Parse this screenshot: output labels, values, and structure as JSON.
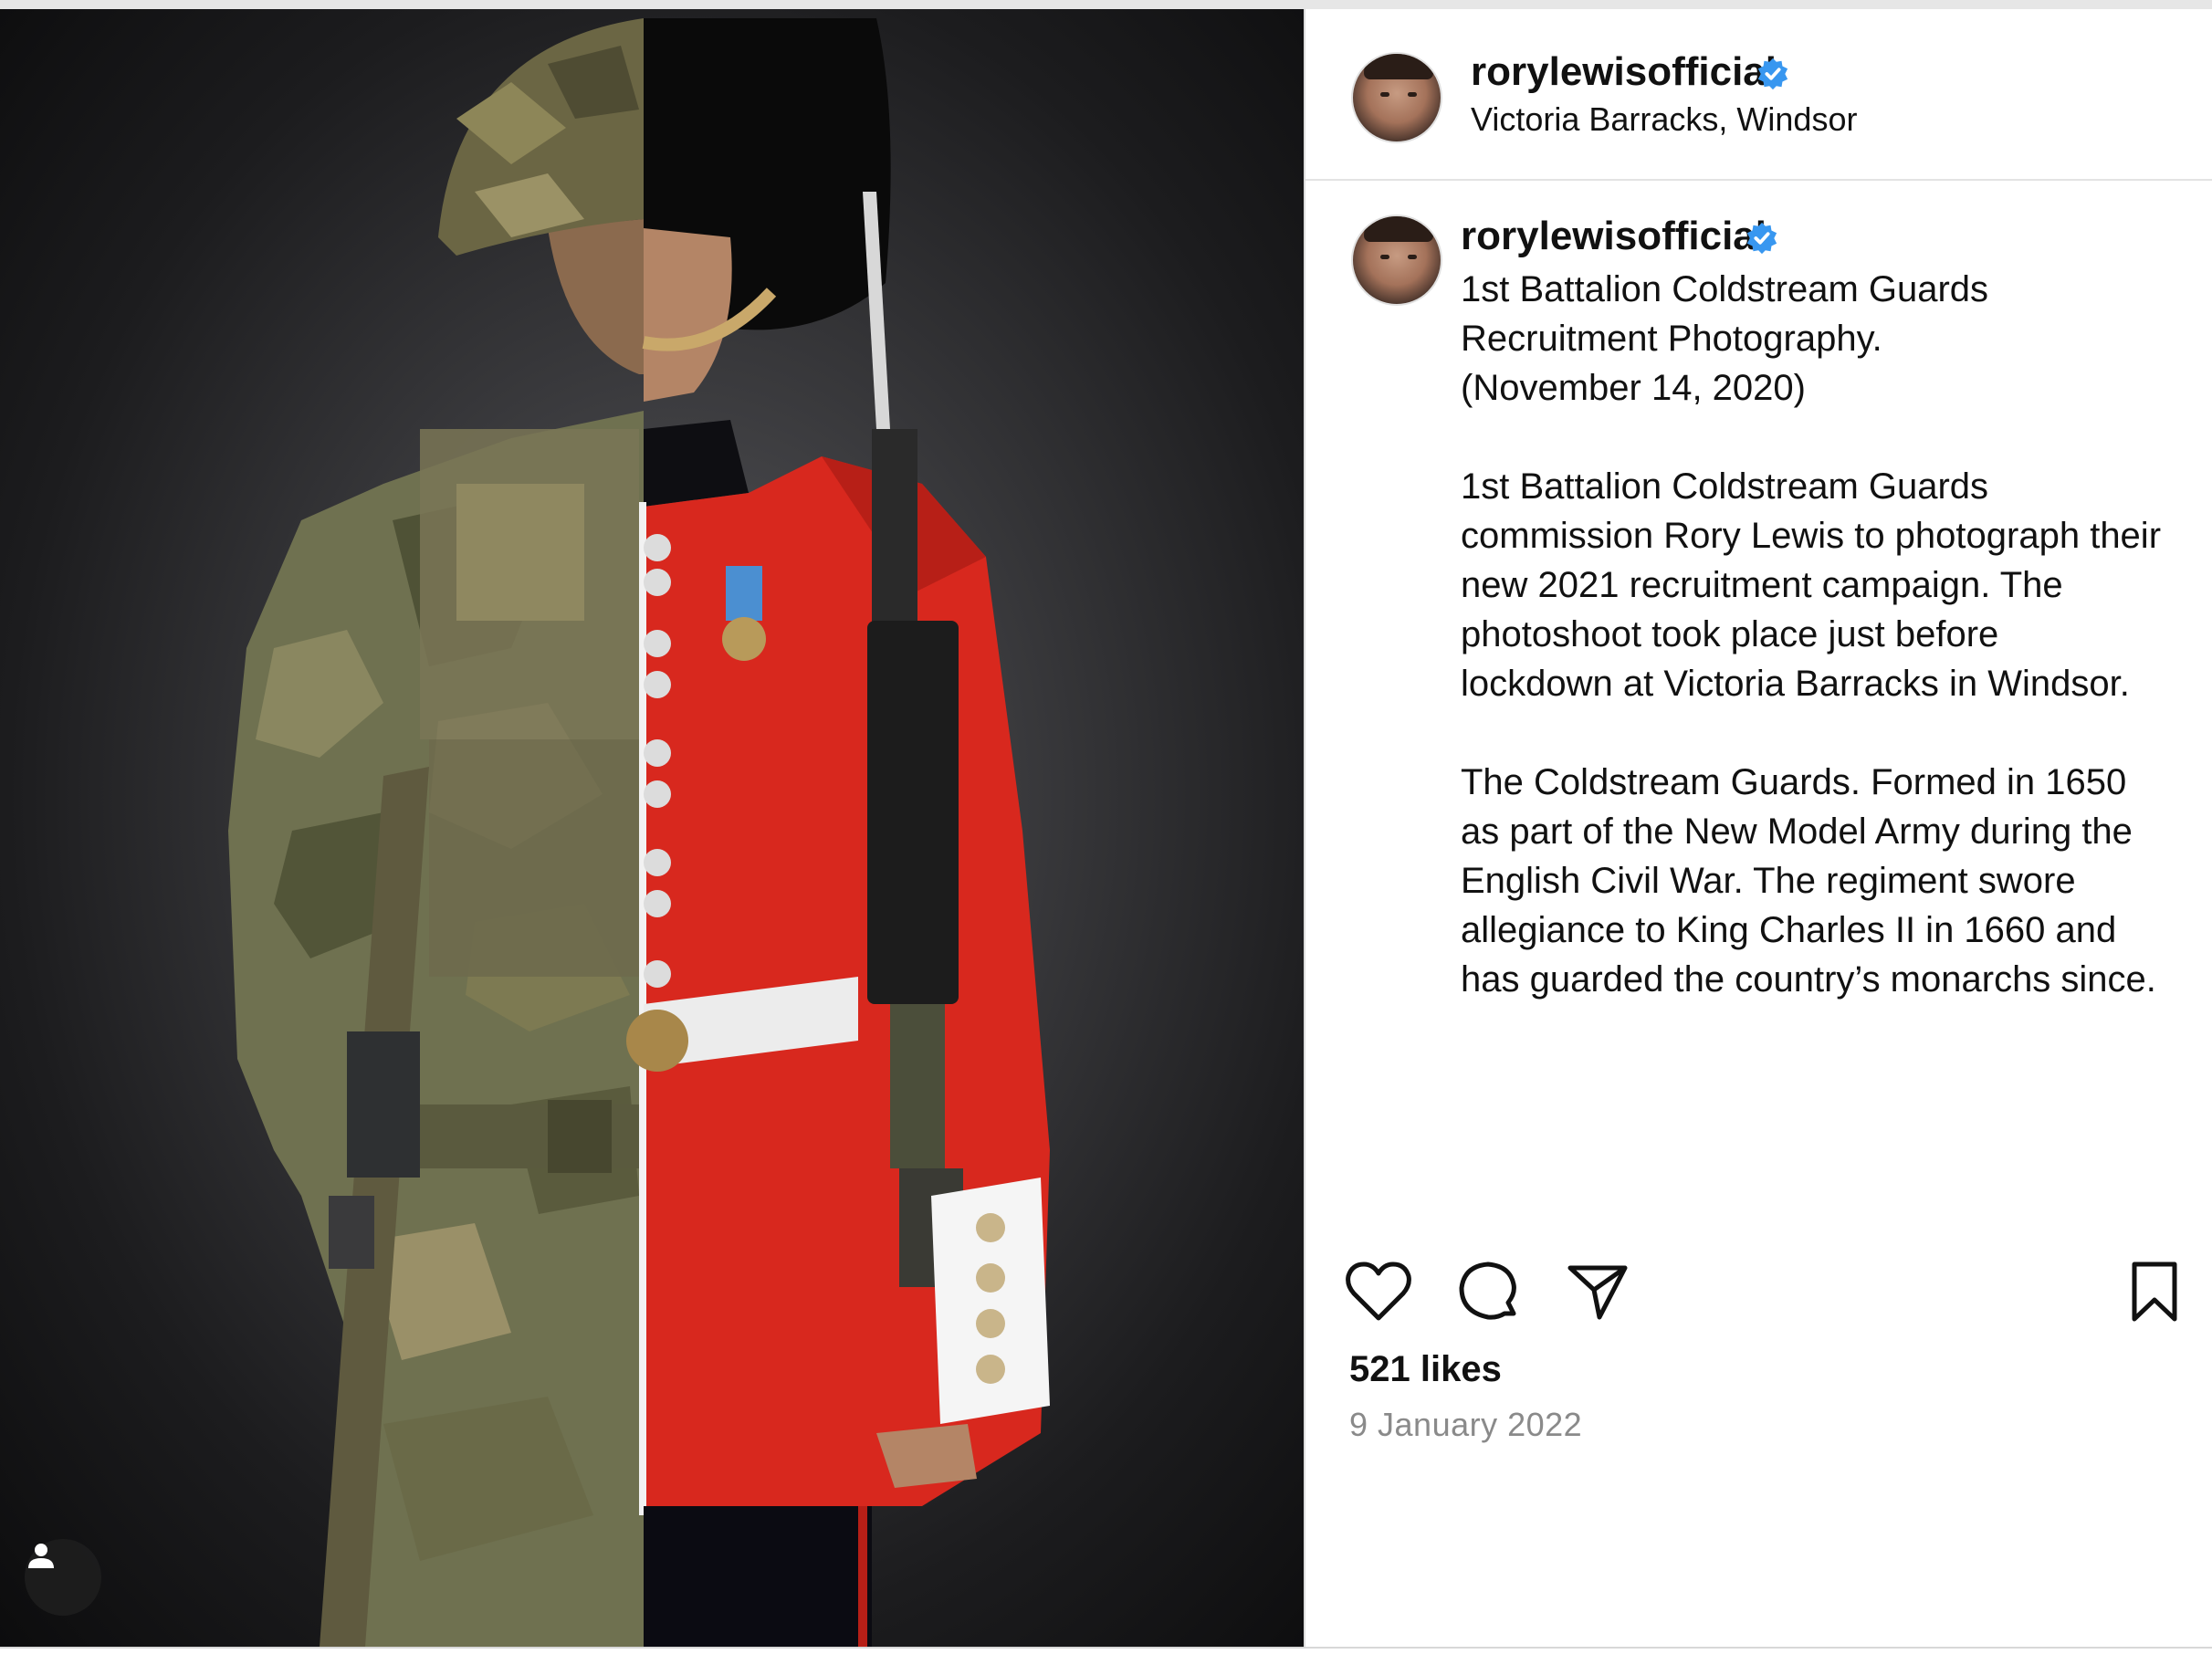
{
  "post": {
    "username": "rorylewisofficial",
    "location": "Victoria Barracks, Windsor",
    "caption": "1st Battalion Coldstream Guards\nRecruitment Photography.\n(November 14, 2020)\n\n1st Battalion Coldstream Guards\ncommission Rory Lewis to photograph their\nnew 2021 recruitment campaign. The\nphotoshoot took place just before\nlockdown at Victoria Barracks in Windsor.\n\nThe Coldstream Guards. Formed in 1650\nas part of the New Model Army during the\nEnglish Civil War. The regiment swore\nallegiance to King Charles II in 1660 and\nhas guarded the country’s monarchs since.",
    "likes": "521 likes",
    "date": "9 January 2022"
  },
  "icons": {
    "verified": "verified-badge-icon",
    "like": "heart-icon",
    "comment": "comment-bubble-icon",
    "share": "paper-plane-icon",
    "save": "bookmark-icon",
    "tags": "user-tag-icon"
  },
  "colors": {
    "verified_blue": "#3897f0",
    "guard_red": "#d8281e",
    "muted_text": "#8a8a8a"
  }
}
